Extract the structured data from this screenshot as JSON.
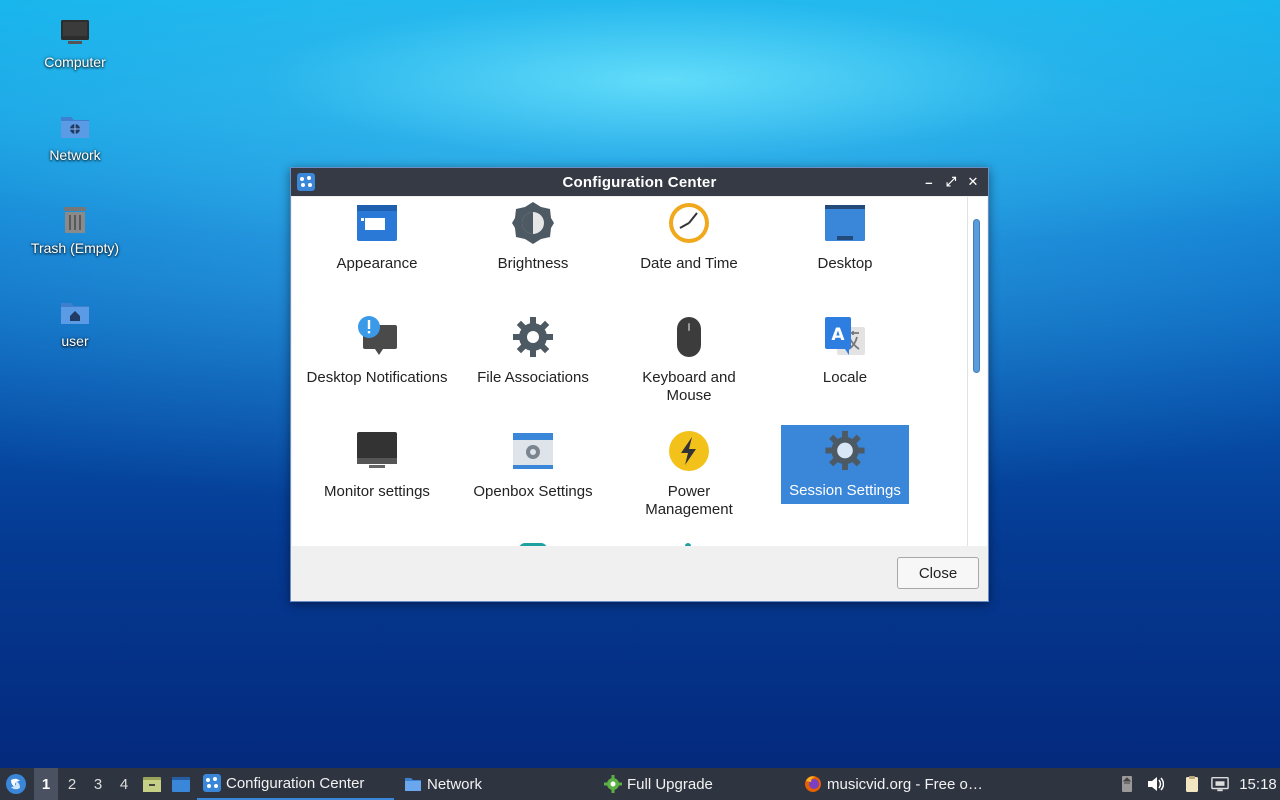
{
  "desktop": {
    "icons": [
      {
        "label": "Computer"
      },
      {
        "label": "Network"
      },
      {
        "label": "Trash (Empty)"
      },
      {
        "label": "user"
      }
    ]
  },
  "window": {
    "title": "Configuration Center",
    "items": [
      {
        "label": "Appearance"
      },
      {
        "label": "Brightness"
      },
      {
        "label": "Date and Time"
      },
      {
        "label": "Desktop"
      },
      {
        "label": "Desktop Notifications"
      },
      {
        "label": "File Associations"
      },
      {
        "label": "Keyboard and Mouse"
      },
      {
        "label": "Locale"
      },
      {
        "label": "Monitor settings"
      },
      {
        "label": "Openbox Settings"
      },
      {
        "label": "Power Management"
      },
      {
        "label": "Session Settings"
      }
    ],
    "selected": "Session Settings",
    "close_label": "Close"
  },
  "taskbar": {
    "workspaces": [
      "1",
      "2",
      "3",
      "4"
    ],
    "active_workspace": "1",
    "tasks": [
      {
        "label": "Configuration Center"
      },
      {
        "label": "Network"
      },
      {
        "label": "Full Upgrade"
      },
      {
        "label": "musicvid.org - Free o…"
      }
    ],
    "clock": "15:18"
  },
  "colors": {
    "accent": "#3a86d8",
    "titlebar": "#353a45",
    "taskbar": "#2f3540"
  }
}
